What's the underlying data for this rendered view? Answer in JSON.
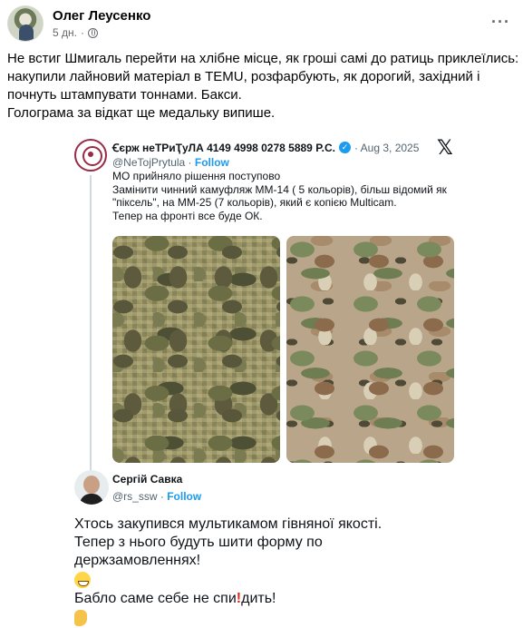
{
  "post": {
    "author": "Олег Леусенко",
    "time": "5 дн.",
    "dot": "·",
    "more": "···",
    "text_lines": [
      "Не встиг Шмигаль перейти на хлібне місце, як гроші самі до ратиць приклеїлись: накупили лайновий матеріал в TEMU, розфарбують, як дорогий, західний і почнуть штампувати тоннами. Бакси.",
      "Голограма за відкат ще медальку випише."
    ]
  },
  "tweet": {
    "name": "Ꞓєрж неТРиҬуЛА 4149 4998 0278 5889 P.C.",
    "verified": "✓",
    "date": "· Aug 3, 2025",
    "x_logo": "𝕏",
    "handle": "@NeTojPrytula",
    "follow_dot": " · ",
    "follow": "Follow",
    "body_lines": [
      "МО прийняло рішення поступово",
      "Замінити чинний камуфляж ММ-14 ( 5 кольорів), більш відомий як",
      "\"піксель\", на ММ-25 (7 кольорів), який є копією Multicam.",
      "Тепер на фронті все буде ОК."
    ]
  },
  "reply": {
    "name": "Сергій Савка",
    "handle": "@rs_ssw",
    "follow_dot": " · ",
    "follow": "Follow",
    "line1": "Хтось закупився мультикамом гівняної якості.",
    "line2": "Тепер з нього будуть шити форму по",
    "line3": "держзамовленнях!",
    "line4_before": "Бабло саме себе не спи",
    "line4_mark": "!",
    "line4_after": "дить!"
  },
  "icons": {
    "globe": "globe-icon",
    "more": "more-options-icon",
    "verified": "verified-badge-icon",
    "x": "x-logo-icon",
    "emoji1": "grinning-face-emoji",
    "emoji2": "thumbs-up-emoji"
  },
  "colors": {
    "link_blue": "#1d9bf0",
    "meta_gray": "#65676b",
    "logo_red": "#9b2a45"
  }
}
